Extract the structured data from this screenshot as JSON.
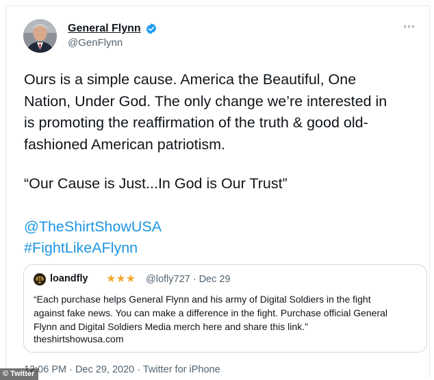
{
  "tweet": {
    "display_name": "General Flynn",
    "handle": "@GenFlynn",
    "verified_icon": "verified-badge-icon",
    "more_label": "◦◦◦",
    "body": "Ours is a simple cause. America the Beautiful, One\nNation, Under God. The only change we’re interested in\nis promoting the reaffirmation of the truth & good old-\nfashioned American patriotism.",
    "quote_line": "“Our Cause is Just...In God is Our Trust”",
    "mention": "@TheShirtShowUSA",
    "hashtag": "#FightLikeAFlynn",
    "meta": "12:06 PM · Dec 29, 2020 · Twitter for iPhone"
  },
  "quoted_tweet": {
    "name": "loandfly",
    "stars": "★★★",
    "handle_date": "@lofly727 · Dec 29",
    "body": "“Each purchase helps General Flynn and his army of Digital Soldiers in the fight\nagainst fake news. You can make a difference in the fight. Purchase official General\nFlynn and Digital Soldiers Media merch here and share this link.”",
    "url": "theshirtshowusa.com"
  },
  "credit": {
    "label": "© Twitter"
  },
  "colors": {
    "link": "#1b95e0",
    "verified": "#1d9bf0",
    "secondary_text": "#536471",
    "stars": "#f0a92e"
  }
}
